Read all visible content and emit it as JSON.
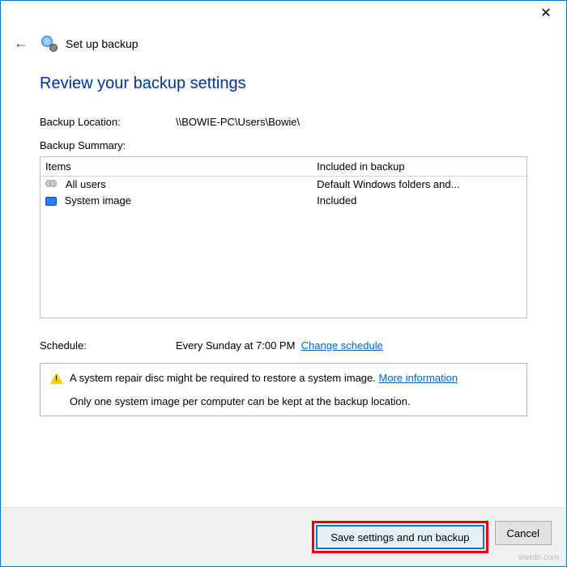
{
  "wizard": {
    "title": "Set up backup"
  },
  "page": {
    "heading": "Review your backup settings",
    "location_label": "Backup Location:",
    "location_value": "\\\\BOWIE-PC\\Users\\Bowie\\",
    "summary_label": "Backup Summary:",
    "schedule_label": "Schedule:",
    "schedule_value": "Every Sunday at 7:00 PM",
    "schedule_link": "Change schedule"
  },
  "summary": {
    "col_items": "Items",
    "col_included": "Included in backup",
    "rows": [
      {
        "item": "All users",
        "included": "Default Windows folders and..."
      },
      {
        "item": "System image",
        "included": "Included"
      }
    ]
  },
  "warning": {
    "line1": "A system repair disc might be required to restore a system image.",
    "link": "More information",
    "line2": "Only one system image per computer can be kept at the backup location."
  },
  "buttons": {
    "primary": "Save settings and run backup",
    "cancel": "Cancel"
  },
  "watermark": "wsxdn.com"
}
